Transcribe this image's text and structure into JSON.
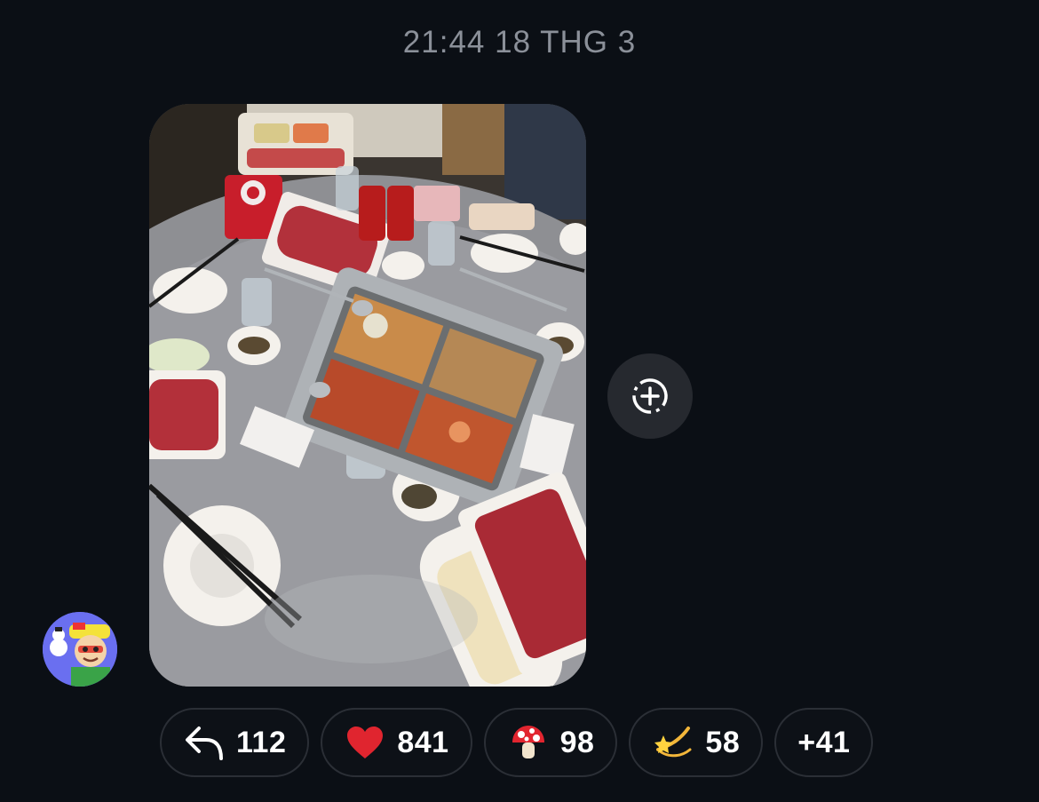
{
  "message": {
    "timestamp": "21:44 18 THG 3"
  },
  "reactions": {
    "reply": {
      "icon": "reply-arrow-icon",
      "count": "112"
    },
    "heart": {
      "icon": "red-heart-emoji",
      "count": "841"
    },
    "mushroom": {
      "icon": "mushroom-emoji",
      "count": "98"
    },
    "dizzy": {
      "icon": "dizzy-star-emoji",
      "count": "58"
    },
    "more": {
      "label": "+41"
    }
  },
  "share_button": {
    "icon": "add-to-story-icon"
  },
  "colors": {
    "background": "#0b0f15",
    "pill_border": "#2b2f36",
    "timestamp": "#8b9099",
    "share_button_bg": "#26292f",
    "avatar_bg": "#6a6ff0"
  }
}
